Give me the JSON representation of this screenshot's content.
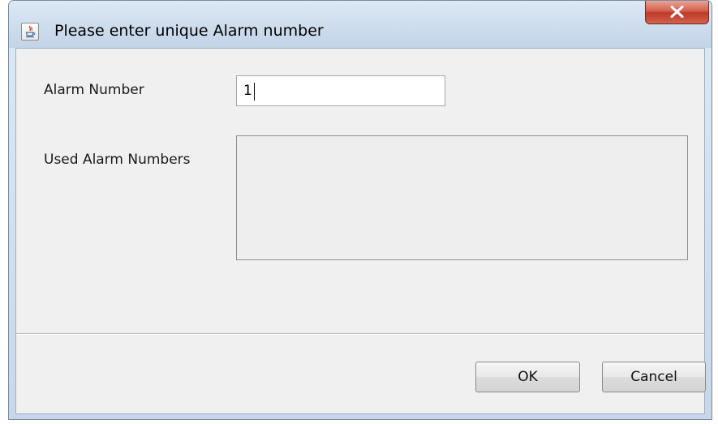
{
  "window": {
    "title": "Please enter unique Alarm number",
    "app_icon": "java-cup-icon",
    "close_icon": "close-icon"
  },
  "form": {
    "alarm_number_label": "Alarm Number",
    "alarm_number_value": "1",
    "used_alarm_numbers_label": "Used Alarm Numbers",
    "used_alarm_numbers": []
  },
  "buttons": {
    "ok_label": "OK",
    "cancel_label": "Cancel"
  },
  "colors": {
    "close_button": "#c7402f",
    "dialog_background": "#f0f0f0",
    "title_bar": "#cfdeee"
  }
}
